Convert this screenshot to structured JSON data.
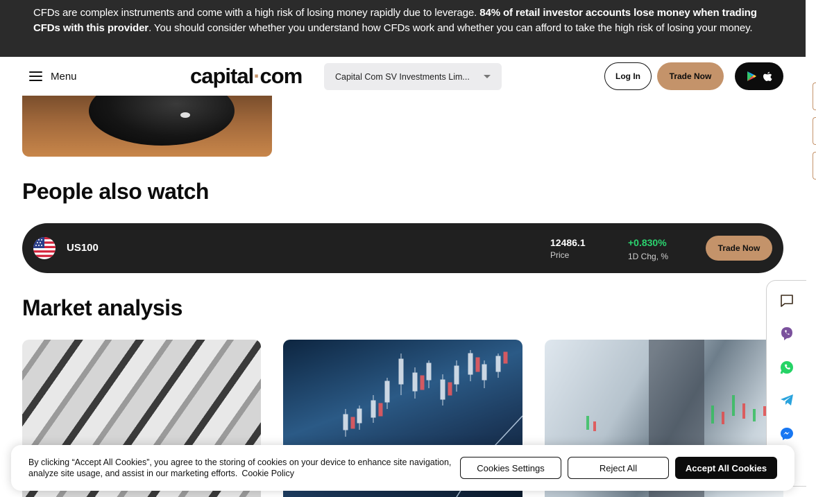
{
  "risk_banner": {
    "text_start": "CFDs are complex instruments and come with a high risk of losing money rapidly due to leverage. ",
    "text_bold": "84% of retail investor accounts lose money when trading CFDs with this provider",
    "text_end": ". You should consider whether you understand how CFDs work and whether you can afford to take the high risk of losing your money."
  },
  "header": {
    "menu_label": "Menu",
    "logo_left": "capital",
    "logo_dot": "·",
    "logo_right": "com",
    "entity_select": "Capital Com SV Investments Lim...",
    "login_label": "Log In",
    "trade_label": "Trade Now",
    "app_icons": [
      "google-play-icon",
      "apple-icon"
    ]
  },
  "people_also_watch": {
    "title": "People also watch",
    "items": [
      {
        "symbol": "US100",
        "flag": "us-flag-icon",
        "price": "12486.1",
        "price_label": "Price",
        "change": "+0.830%",
        "change_label": "1D Chg, %",
        "trade_label": "Trade Now"
      }
    ]
  },
  "market_analysis": {
    "title": "Market analysis"
  },
  "messengers": [
    "chat-icon",
    "viber-icon",
    "whatsapp-icon",
    "telegram-icon",
    "messenger-icon"
  ],
  "cookie_banner": {
    "text": "By clicking “Accept All Cookies”, you agree to the storing of cookies on your device to enhance site navigation, analyze site usage, and assist in our marketing efforts.",
    "policy_link": "Cookie Policy",
    "settings_label": "Cookies Settings",
    "reject_label": "Reject All",
    "accept_label": "Accept All Cookies"
  },
  "colors": {
    "accent": "#c4936a",
    "banner_bg": "#2b2b2b",
    "positive": "#2bd46f",
    "dark_row": "#202020"
  }
}
